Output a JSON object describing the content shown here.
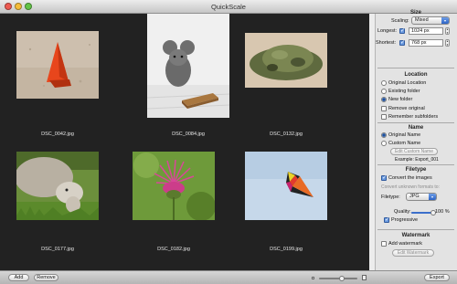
{
  "window": {
    "title": "QuickScale"
  },
  "thumbnails": [
    {
      "filename": "DSC_0042.jpg",
      "subject": "orange traffic cone in sand"
    },
    {
      "filename": "DSC_0084.jpg",
      "subject": "toy mouse figurine and mousetrap"
    },
    {
      "filename": "DSC_0132.jpg",
      "subject": "green camouflage hat on sand"
    },
    {
      "filename": "DSC_0177.jpg",
      "subject": "sheep grazing grass"
    },
    {
      "filename": "DSC_0182.jpg",
      "subject": "pink thistle flower"
    },
    {
      "filename": "DSC_0199.jpg",
      "subject": "kite in sky"
    }
  ],
  "size": {
    "title": "Size",
    "scaling_label": "Scaling:",
    "scaling_value": "Mixed",
    "longest_label": "Longest:",
    "longest_value": "1024 px",
    "shortest_label": "Shortest:",
    "shortest_value": "768 px"
  },
  "location": {
    "title": "Location",
    "options": [
      "Original Location",
      "Existing folder",
      "New folder"
    ],
    "selected": "New folder",
    "remove_original": "Remove original",
    "remember_subfolders": "Remember subfolders"
  },
  "name": {
    "title": "Name",
    "options": [
      "Original Name",
      "Custom Name"
    ],
    "selected": "Original Name",
    "edit_button": "Edit Custom Name",
    "example": "Example: Export_001"
  },
  "filetype": {
    "title": "Filetype",
    "convert_label": "Convert the images",
    "convert_unknown": "Convert unknown formats to:",
    "filetype_label": "Filetype:",
    "filetype_value": "JPG",
    "quality_label": "Quality:",
    "quality_value": "100 %",
    "quality_level": 1.0,
    "progressive_label": "Progressive"
  },
  "watermark": {
    "title": "Watermark",
    "add_label": "Add watermark",
    "edit_button": "Edit Watermark"
  },
  "bottom": {
    "add_label": "Add",
    "remove_label": "Remove",
    "export_label": "Export",
    "zoom_level": 0.6
  },
  "colors": {
    "grid_background": "#222222",
    "accent_blue": "#2b62c4"
  }
}
